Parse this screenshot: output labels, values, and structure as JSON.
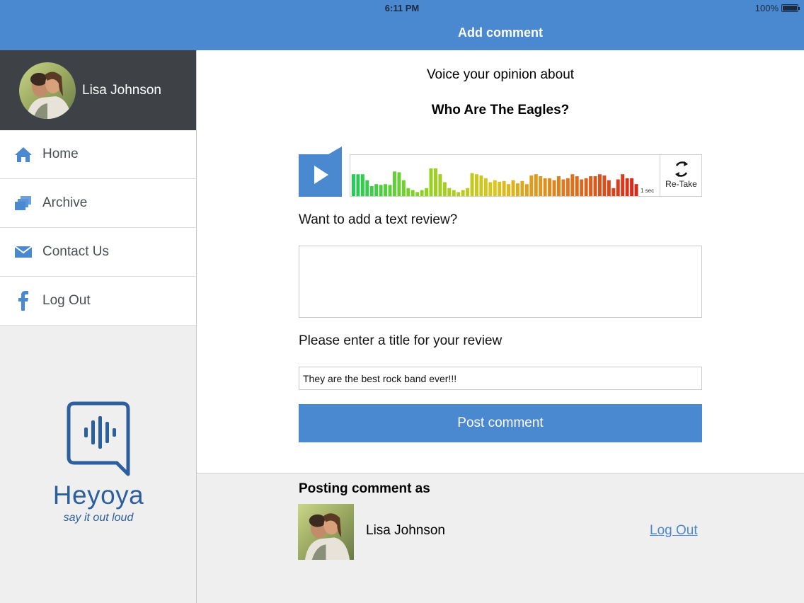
{
  "status_bar": {
    "time": "6:11 PM",
    "battery": "100%"
  },
  "nav": {
    "title": "Add comment"
  },
  "sidebar": {
    "user_name": "Lisa Johnson",
    "items": [
      {
        "label": "Home",
        "icon": "home-icon"
      },
      {
        "label": "Archive",
        "icon": "archive-icon"
      },
      {
        "label": "Contact Us",
        "icon": "envelope-icon"
      },
      {
        "label": "Log Out",
        "icon": "facebook-icon"
      }
    ],
    "logo": {
      "name": "Heyoya",
      "tagline": "say it out loud"
    }
  },
  "main": {
    "voice_label": "Voice your opinion about",
    "topic_title": "Who Are The Eagles?",
    "player": {
      "duration": "1 sec",
      "retake_label": "Re-Take",
      "waveform_levels": [
        0.55,
        0.55,
        0.55,
        0.4,
        0.25,
        0.3,
        0.28,
        0.3,
        0.28,
        0.62,
        0.6,
        0.4,
        0.2,
        0.15,
        0.1,
        0.15,
        0.2,
        0.7,
        0.7,
        0.55,
        0.35,
        0.2,
        0.15,
        0.1,
        0.15,
        0.2,
        0.58,
        0.55,
        0.52,
        0.45,
        0.35,
        0.4,
        0.36,
        0.38,
        0.3,
        0.4,
        0.32,
        0.38,
        0.3,
        0.52,
        0.55,
        0.5,
        0.45,
        0.45,
        0.4,
        0.5,
        0.42,
        0.45,
        0.55,
        0.5,
        0.42,
        0.45,
        0.5,
        0.5,
        0.55,
        0.52,
        0.4,
        0.2,
        0.42,
        0.55,
        0.45,
        0.45,
        0.3
      ],
      "waveform_colors": [
        "#22cc55",
        "#8fd21f",
        "#dcc51d",
        "#de7a1d",
        "#d8281a"
      ]
    },
    "text_review_question": "Want to add a text review?",
    "text_review_value": "",
    "title_label": "Please enter a title for your review",
    "title_value": "They are the best rock band ever!!!",
    "post_button": "Post comment"
  },
  "footer": {
    "posting_as_label": "Posting comment as",
    "user_name": "Lisa Johnson",
    "logout_label": "Log Out"
  },
  "colors": {
    "accent": "#4a88cf",
    "profile_bg": "#3e4247",
    "logo": "#2c5f9e"
  }
}
